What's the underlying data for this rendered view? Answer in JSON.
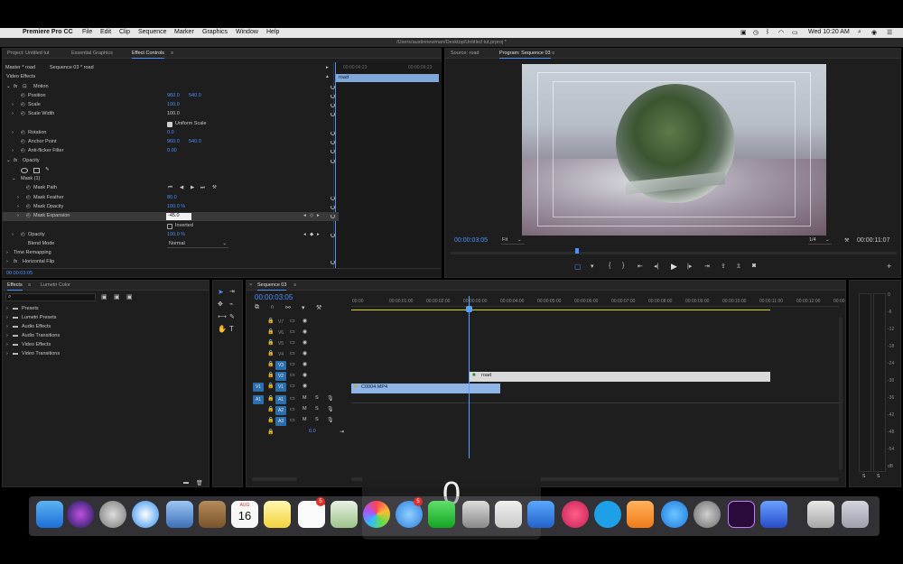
{
  "menubar": {
    "app_name": "Premiere Pro CC",
    "items": [
      "File",
      "Edit",
      "Clip",
      "Sequence",
      "Marker",
      "Graphics",
      "Window",
      "Help"
    ],
    "clock": "Wed 10:20 AM"
  },
  "title_path": "/Users/austinnewman/Desktop/Untitled tut.prproj *",
  "left_tabs": [
    "Project: Untitled tut",
    "Essential Graphics",
    "Effect Controls"
  ],
  "effect_controls": {
    "master": "Master * road",
    "sequence": "Sequence 03 * road",
    "mini_ruler_start": "00:00:04:23",
    "mini_ruler_end": "00:00:09:23",
    "mini_clip": "road",
    "video_effects": "Video Effects",
    "motion": "Motion",
    "position_label": "Position",
    "position_x": "960.0",
    "position_y": "540.0",
    "scale_label": "Scale",
    "scale_value": "100.0",
    "scale_width_label": "Scale Width",
    "scale_width_value": "100.0",
    "uniform_scale": "Uniform Scale",
    "rotation_label": "Rotation",
    "rotation_value": "0.0",
    "anchor_label": "Anchor Point",
    "anchor_x": "960.0",
    "anchor_y": "540.0",
    "antiflicker_label": "Anti-flicker Filter",
    "antiflicker_value": "0.00",
    "opacity": "Opacity",
    "mask_group": "Mask (1)",
    "mask_path": "Mask Path",
    "mask_feather_label": "Mask Feather",
    "mask_feather_value": "80.0",
    "mask_opacity_label": "Mask Opacity",
    "mask_opacity_value": "100.0 %",
    "mask_expansion_label": "Mask Expansion",
    "mask_expansion_value": "-45.0",
    "inverted": "Inverted",
    "opacity_label": "Opacity",
    "opacity_value": "100.0 %",
    "blend_label": "Blend Mode",
    "blend_value": "Normal",
    "time_remap": "Time Remapping",
    "hflip": "Horizontal Flip",
    "timecode": "00:00:03:05"
  },
  "monitor": {
    "tabs": [
      "Source: road",
      "Program: Sequence 03"
    ],
    "timecode": "00:00:03:05",
    "fit": "Fit",
    "quality": "1/4",
    "duration": "00:00:11:07"
  },
  "effects_panel": {
    "tabs": [
      "Effects",
      "Lumetri Color"
    ],
    "folders": [
      "Presets",
      "Lumetri Presets",
      "Audio Effects",
      "Audio Transitions",
      "Video Effects",
      "Video Transitions"
    ]
  },
  "timeline": {
    "tab": "Sequence 03",
    "timecode": "00:00:03:05",
    "ruler": [
      "00:00",
      "00:00:01:00",
      "00:00:02:00",
      "00:00:03:00",
      "00:00:04:00",
      "00:00:05:00",
      "00:00:06:00",
      "00:00:07:00",
      "00:00:08:00",
      "00:00:09:00",
      "00:00:10:00",
      "00:00:11:00",
      "00:00:12:00",
      "00:00"
    ],
    "video_tracks": [
      "V7",
      "V6",
      "V5",
      "V4",
      "V3",
      "V2",
      "V1"
    ],
    "audio_tracks": [
      "A1",
      "A2",
      "A3"
    ],
    "src_v": "V1",
    "src_a": "A1",
    "master_value": "0.0",
    "clip_road": "road",
    "clip_c0004": "C0004.MP4"
  },
  "meter_scale": [
    "0",
    "-6",
    "-12",
    "-18",
    "-24",
    "-30",
    "-36",
    "-42",
    "-48",
    "-54",
    "dB"
  ],
  "meter_solo": [
    "S",
    "S"
  ],
  "overlay_number": "0",
  "dock_badges": {
    "calendar_month": "AUG",
    "calendar_day": "16",
    "reminders": "5",
    "messages": "5"
  },
  "colors": {
    "accent": "#4a90ff",
    "clip_video": "#8fb4e6",
    "clip_adj": "#d9d9d9",
    "playhead": "#5aa0ff"
  }
}
